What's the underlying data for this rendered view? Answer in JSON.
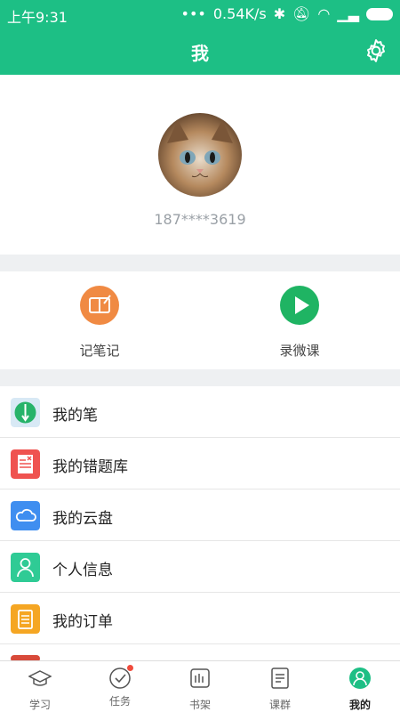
{
  "status_bar": {
    "time": "上午9:31",
    "speed": "0.54K/s"
  },
  "header": {
    "title": "我"
  },
  "profile": {
    "phone": "187****3619"
  },
  "actions": [
    {
      "label": "记笔记"
    },
    {
      "label": "录微课"
    }
  ],
  "menu": [
    {
      "label": "我的笔"
    },
    {
      "label": "我的错题库"
    },
    {
      "label": "我的云盘"
    },
    {
      "label": "个人信息"
    },
    {
      "label": "我的订单"
    }
  ],
  "tabs": [
    {
      "label": "学习"
    },
    {
      "label": "任务"
    },
    {
      "label": "书架"
    },
    {
      "label": "课群"
    },
    {
      "label": "我的"
    }
  ],
  "colors": {
    "brand_green": "#1dbf85",
    "note_orange": "#f08a43",
    "microclass_green": "#1fb463"
  }
}
